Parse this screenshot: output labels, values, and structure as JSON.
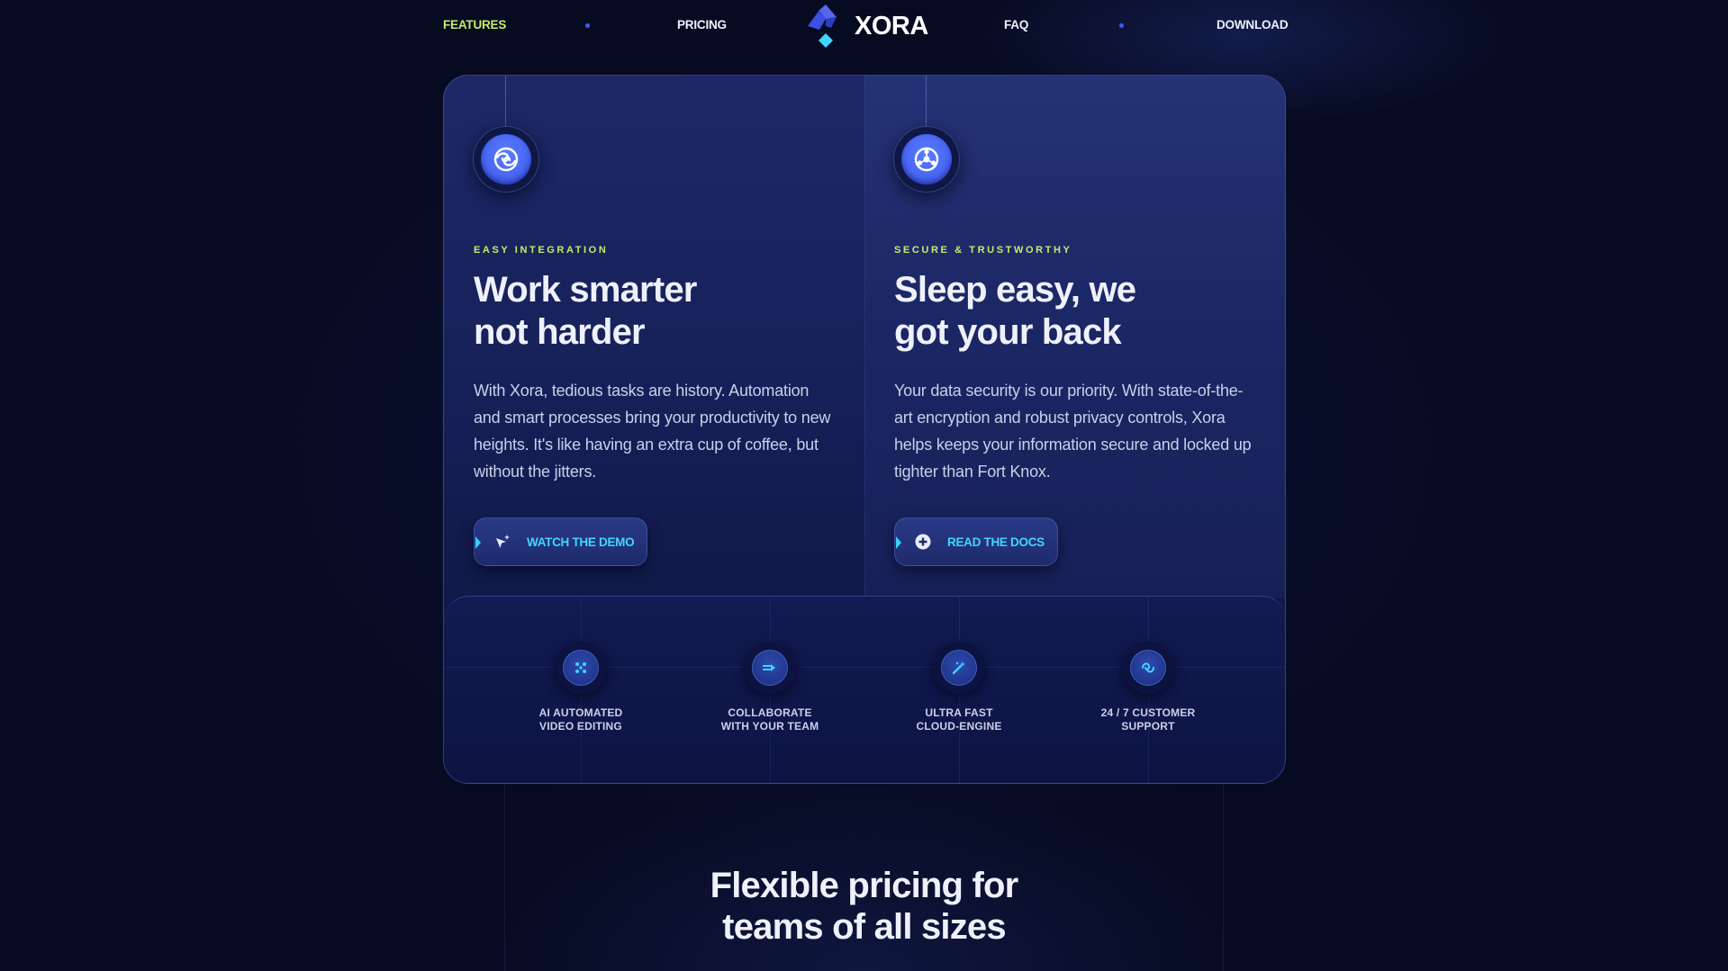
{
  "nav": {
    "items": [
      {
        "label": "FEATURES",
        "active": true
      },
      {
        "label": "PRICING",
        "active": false
      },
      {
        "label": "FAQ",
        "active": false
      },
      {
        "label": "DOWNLOAD",
        "active": false
      }
    ],
    "logo_text": "XORA"
  },
  "features": [
    {
      "eyebrow": "EASY INTEGRATION",
      "title_line1": "Work smarter",
      "title_line2": "not harder",
      "body": "With Xora, tedious tasks are history. Automation and smart processes bring your productivity to new heights. It's like having an extra cup of coffee, but without the jitters.",
      "cta": "WATCH THE DEMO",
      "icon": "swirl-icon"
    },
    {
      "eyebrow": "SECURE & TRUSTWORTHY",
      "title_line1": "Sleep easy, we",
      "title_line2": "got your back",
      "body": "Your data security is our priority. With state-of-the-art encryption and robust privacy controls, Xora helps keeps your information secure and locked up tighter than Fort Knox.",
      "cta": "READ THE DOCS",
      "icon": "shield-hub-icon"
    }
  ],
  "details": [
    {
      "line1": "AI AUTOMATED",
      "line2": "VIDEO EDITING",
      "icon": "sparkle-grid-icon"
    },
    {
      "line1": "COLLABORATE",
      "line2": "WITH YOUR TEAM",
      "icon": "arrow-share-icon"
    },
    {
      "line1": "ULTRA FAST",
      "line2": "CLOUD-ENGINE",
      "icon": "magic-wand-icon"
    },
    {
      "line1": "24 / 7 CUSTOMER",
      "line2": "SUPPORT",
      "icon": "support-icon"
    }
  ],
  "pricing": {
    "title_line1": "Flexible pricing for",
    "title_line2": "teams of all sizes"
  },
  "colors": {
    "background": "#070b22",
    "accent_green": "#c5ec6a",
    "accent_cyan": "#3fd6ff",
    "brand_blue": "#3c58ea"
  }
}
